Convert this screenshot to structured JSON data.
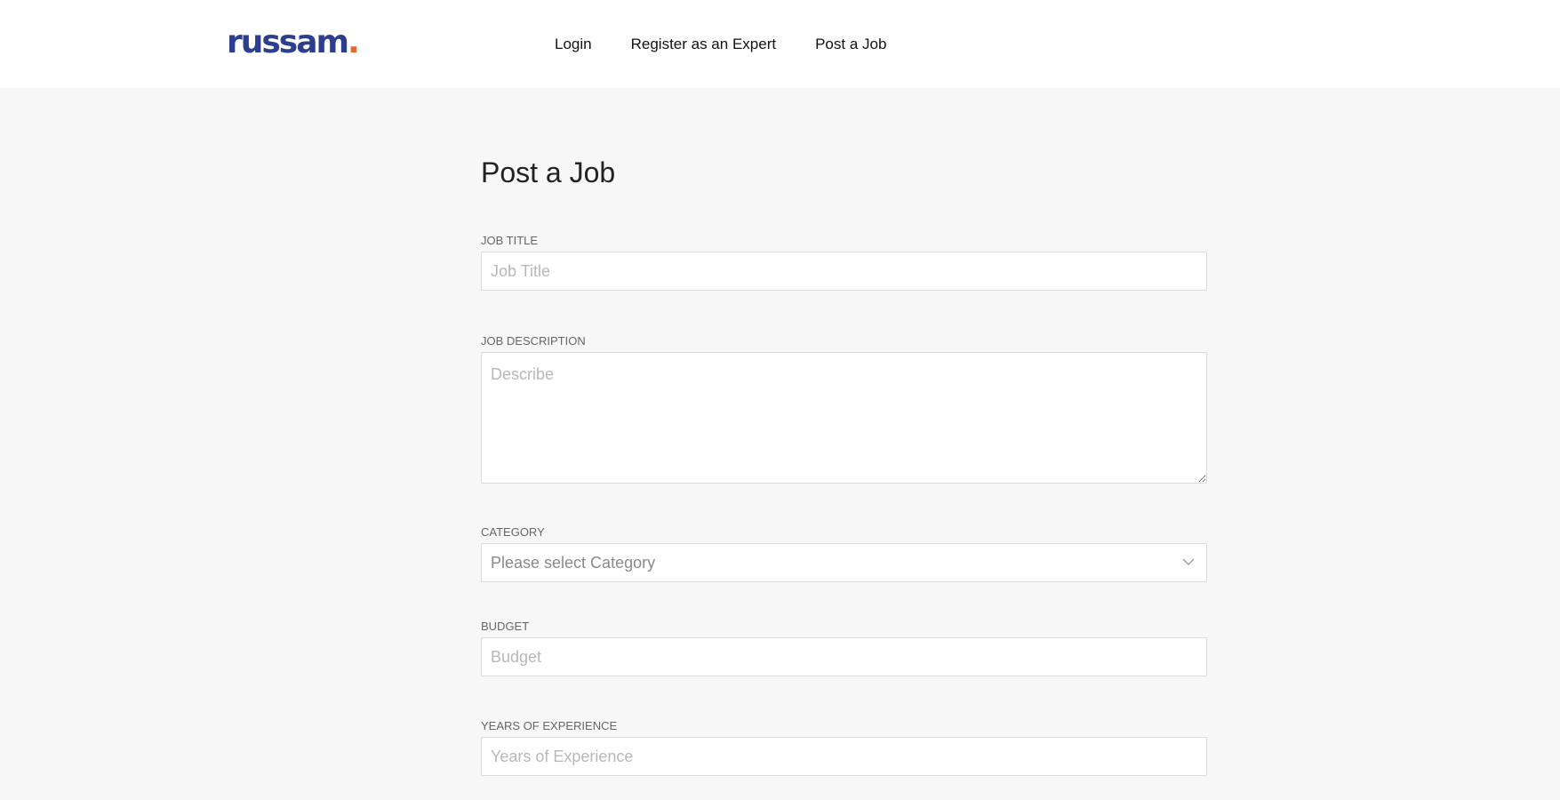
{
  "brand": {
    "name": "russam",
    "dot": "."
  },
  "nav": {
    "login": "Login",
    "register": "Register as an Expert",
    "post_job": "Post a Job"
  },
  "page": {
    "title": "Post a Job"
  },
  "form": {
    "job_title": {
      "label": "JOB TITLE",
      "placeholder": "Job Title"
    },
    "job_description": {
      "label": "JOB DESCRIPTION",
      "placeholder": "Describe"
    },
    "category": {
      "label": "CATEGORY",
      "selected": "Please select Category"
    },
    "budget": {
      "label": "BUDGET",
      "placeholder": "Budget"
    },
    "years_experience": {
      "label": "YEARS OF EXPERIENCE",
      "placeholder": "Years of Experience"
    }
  },
  "colors": {
    "brand_blue": "#2d3e8f",
    "brand_orange": "#e8662b"
  },
  "icons": {
    "select_caret": "chevron-down-icon"
  }
}
